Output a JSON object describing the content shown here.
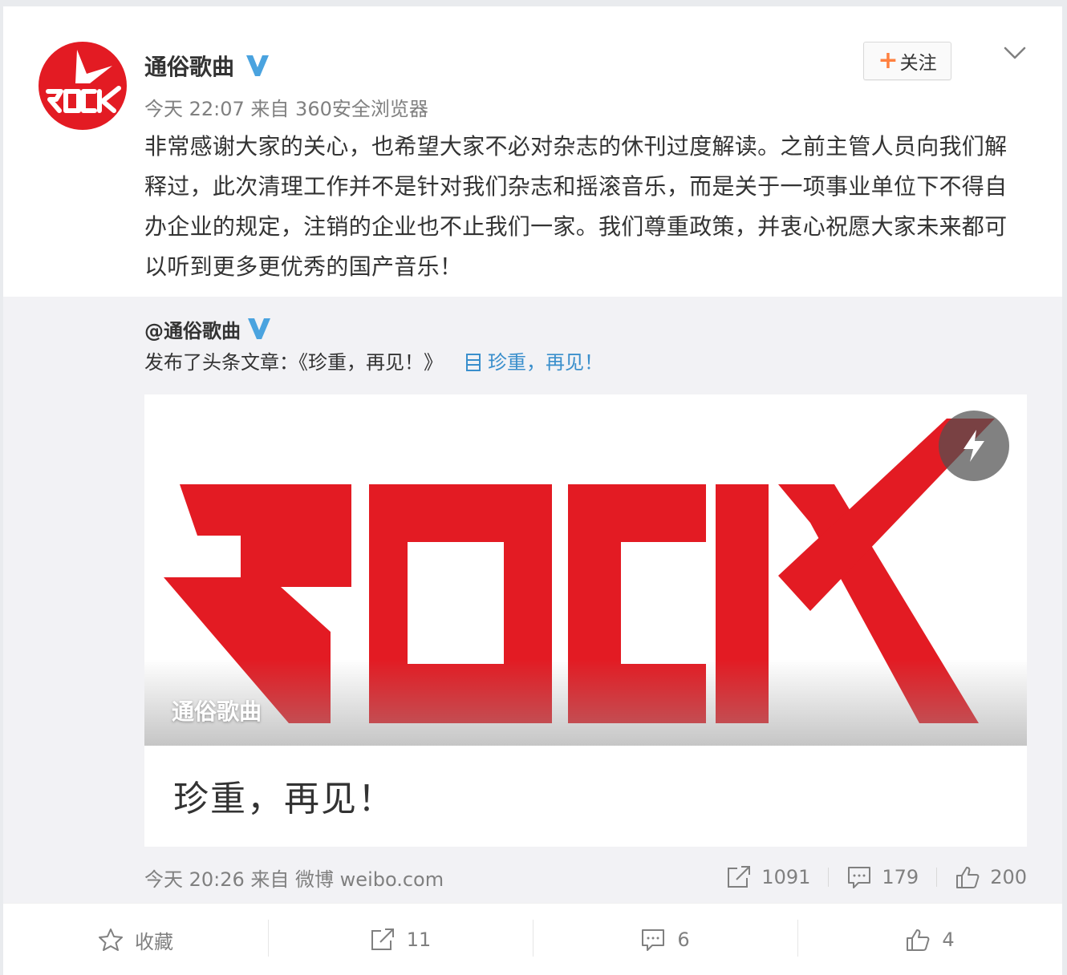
{
  "post": {
    "author": "通俗歌曲",
    "meta": "今天 22:07 来自 360安全浏览器",
    "follow_label": "关注",
    "text": "非常感谢大家的关心，也希望大家不必对杂志的休刊过度解读。之前主管人员向我们解释过，此次清理工作并不是针对我们杂志和摇滚音乐，而是关于一项事业单位下不得自办企业的规定，注销的企业也不止我们一家。我们尊重政策，并衷心祝愿大家未来都可以听到更多更优秀的国产音乐！"
  },
  "repost": {
    "author": "@通俗歌曲",
    "published_text": "发布了头条文章：《珍重，再见！》",
    "article_link_text": "珍重，再见！",
    "card": {
      "caption": "通俗歌曲",
      "title": "珍重，再见！"
    },
    "meta": "今天 20:26 来自 微博 weibo.com",
    "stats": {
      "reposts": "1091",
      "comments": "179",
      "likes": "200"
    }
  },
  "actions": {
    "favorite_label": "收藏",
    "reposts": "11",
    "comments": "6",
    "likes": "4"
  },
  "colors": {
    "brand_red": "#e31b23",
    "link_blue": "#3a8fcc",
    "verified_blue": "#4aa3df",
    "follow_orange": "#ff8140"
  },
  "icons": [
    "verified-v-icon",
    "plus-icon",
    "chevron-down-icon",
    "article-icon",
    "lightning-icon",
    "share-icon",
    "comment-icon",
    "like-icon",
    "star-icon"
  ]
}
